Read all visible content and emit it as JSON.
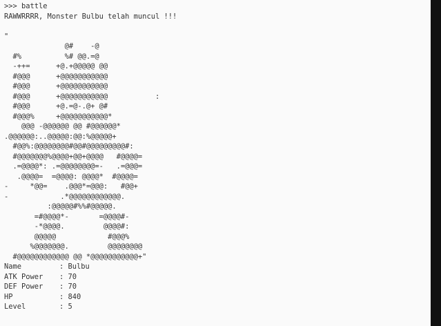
{
  "terminal": {
    "command": ">>> battle",
    "announcement": "RAWWRRRR, Monster Bulbu telah muncul !!!",
    "quote_mark": "\"",
    "art": [
      "              @#    -@",
      "  #%          %# @@.=@",
      "  -++=      +@.+@@@@@ @@",
      "  #@@@      +@@@@@@@@@@@",
      "  #@@@      +@@@@@@@@@@@",
      "  #@@@      +@@@@@@@@@@@           :",
      "  #@@@      +@.=@-.@+ @#",
      "  #@@@%     +@@@@@@@@@@@*",
      "    @@@ -@@@@@@ @@ #@@@@@@*",
      ".@@@@@@:..@@@@@:@@:%@@@@@+",
      "  #@@%:@@@@@@@@#@@#@@@@@@@@@#:",
      "  #@@@@@@@%@@@@+@@+@@@@   #@@@@=",
      "  .=@@@@*: .=@@@@@@@@=-   .=@@@=",
      "   .@@@@=  =@@@@: @@@@*  #@@@@=",
      "-     *@@=    .@@@*=@@@:   #@@+",
      "-            .*@@@@@@@@@@@@.",
      "          :@@@@@#%%#@@@@@.",
      "       =#@@@@*-       =@@@@#-",
      "       -*@@@@.         @@@@#:",
      "       @@@@@            #@@@%",
      "      %@@@@@@@.         @@@@@@@@",
      "  #@@@@@@@@@@@@ @@ *@@@@@@@@@@@+\""
    ]
  },
  "stats": [
    {
      "label": "Name",
      "value": ": Bulbu"
    },
    {
      "label": "ATK Power",
      "value": ": 70"
    },
    {
      "label": "DEF Power",
      "value": ": 70"
    },
    {
      "label": "HP",
      "value": ": 840"
    },
    {
      "label": "Level",
      "value": ": 5"
    }
  ]
}
